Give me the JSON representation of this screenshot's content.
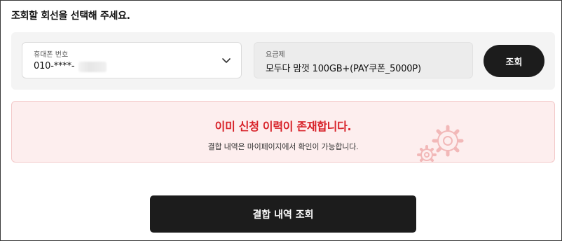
{
  "heading": "조회할 회선을 선택해 주세요.",
  "phone_field": {
    "label": "휴대폰 번호",
    "value": "010-****-"
  },
  "plan_field": {
    "label": "요금제",
    "value": "모두다 맘껏 100GB+(PAY쿠폰_5000P)"
  },
  "lookup_button": "조회",
  "notice": {
    "title": "이미 신청 이력이 존재합니다.",
    "description": "결합 내역은 마이페이지에서 확인이 가능합니다."
  },
  "history_button": "결합 내역 조회",
  "colors": {
    "accent_red": "#d8232a",
    "notice_bg": "#fdeeee",
    "button_dark": "#1c1c1c"
  },
  "icons": {
    "dropdown": "chevron-down-icon",
    "decoration": "gears-icon"
  }
}
